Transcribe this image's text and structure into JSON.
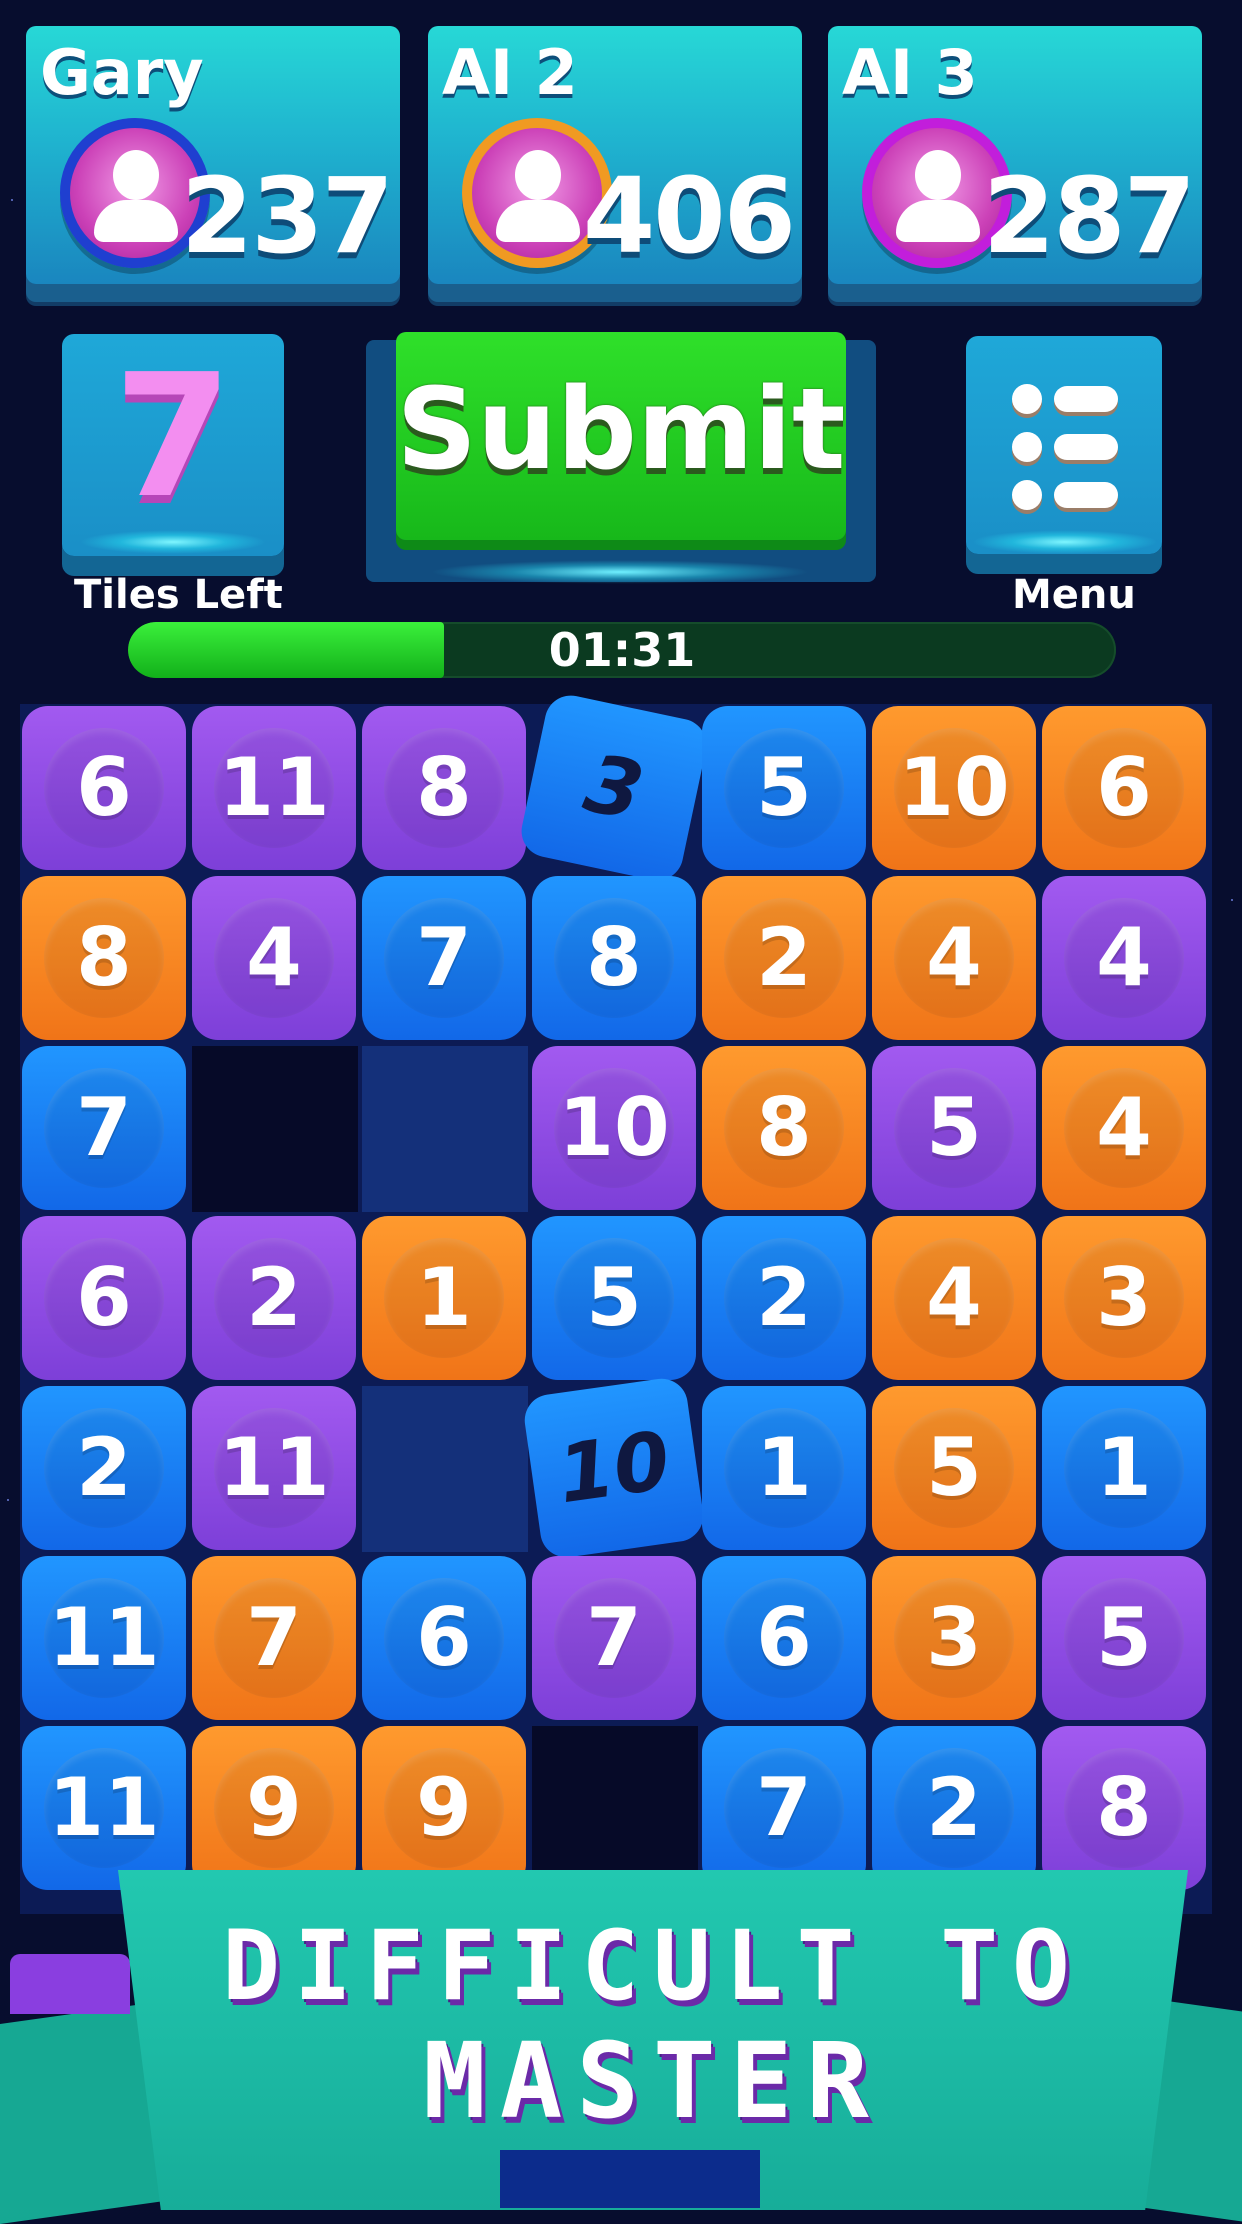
{
  "players": [
    {
      "name": "Gary",
      "score": "237",
      "ring": "#1f3fd0"
    },
    {
      "name": "AI 2",
      "score": "406",
      "ring": "#f09a22"
    },
    {
      "name": "AI 3",
      "score": "287",
      "ring": "#c21edb"
    }
  ],
  "controls": {
    "tiles_left_value": "7",
    "tiles_left_label": "Tiles Left",
    "submit_label": "Submit",
    "menu_label": "Menu"
  },
  "timer": {
    "text": "01:31",
    "progress": 0.32
  },
  "board": {
    "rows": [
      [
        [
          "6",
          "purple"
        ],
        [
          "11",
          "purple"
        ],
        [
          "8",
          "purple"
        ],
        [
          "3",
          "tilt"
        ],
        [
          "5",
          "blue"
        ],
        [
          "10",
          "orange"
        ],
        [
          "6",
          "orange"
        ]
      ],
      [
        [
          "8",
          "orange"
        ],
        [
          "4",
          "purple"
        ],
        [
          "7",
          "blue"
        ],
        [
          "8",
          "blue"
        ],
        [
          "2",
          "orange"
        ],
        [
          "4",
          "orange"
        ],
        [
          "4",
          "purple"
        ]
      ],
      [
        [
          "7",
          "blue"
        ],
        [
          "",
          "hole-dark"
        ],
        [
          "",
          "hole-mid"
        ],
        [
          "10",
          "purple"
        ],
        [
          "8",
          "orange"
        ],
        [
          "5",
          "purple"
        ],
        [
          "4",
          "orange"
        ]
      ],
      [
        [
          "6",
          "purple"
        ],
        [
          "2",
          "purple"
        ],
        [
          "1",
          "orange"
        ],
        [
          "5",
          "blue"
        ],
        [
          "2",
          "blue"
        ],
        [
          "4",
          "orange"
        ],
        [
          "3",
          "orange"
        ]
      ],
      [
        [
          "2",
          "blue"
        ],
        [
          "11",
          "purple"
        ],
        [
          "",
          "hole-mid"
        ],
        [
          "10",
          "tilt"
        ],
        [
          "1",
          "blue"
        ],
        [
          "5",
          "orange"
        ],
        [
          "1",
          "blue"
        ]
      ],
      [
        [
          "11",
          "blue"
        ],
        [
          "7",
          "orange"
        ],
        [
          "6",
          "blue"
        ],
        [
          "7",
          "purple"
        ],
        [
          "6",
          "blue"
        ],
        [
          "3",
          "orange"
        ],
        [
          "5",
          "purple"
        ]
      ],
      [
        [
          "11",
          "blue"
        ],
        [
          "9",
          "orange"
        ],
        [
          "9",
          "orange"
        ],
        [
          "",
          "hole-dark"
        ],
        [
          "7",
          "blue"
        ],
        [
          "2",
          "blue"
        ],
        [
          "8",
          "purple"
        ]
      ]
    ]
  },
  "banner": {
    "line1": "DIFFICULT TO",
    "line2": "MASTER"
  }
}
